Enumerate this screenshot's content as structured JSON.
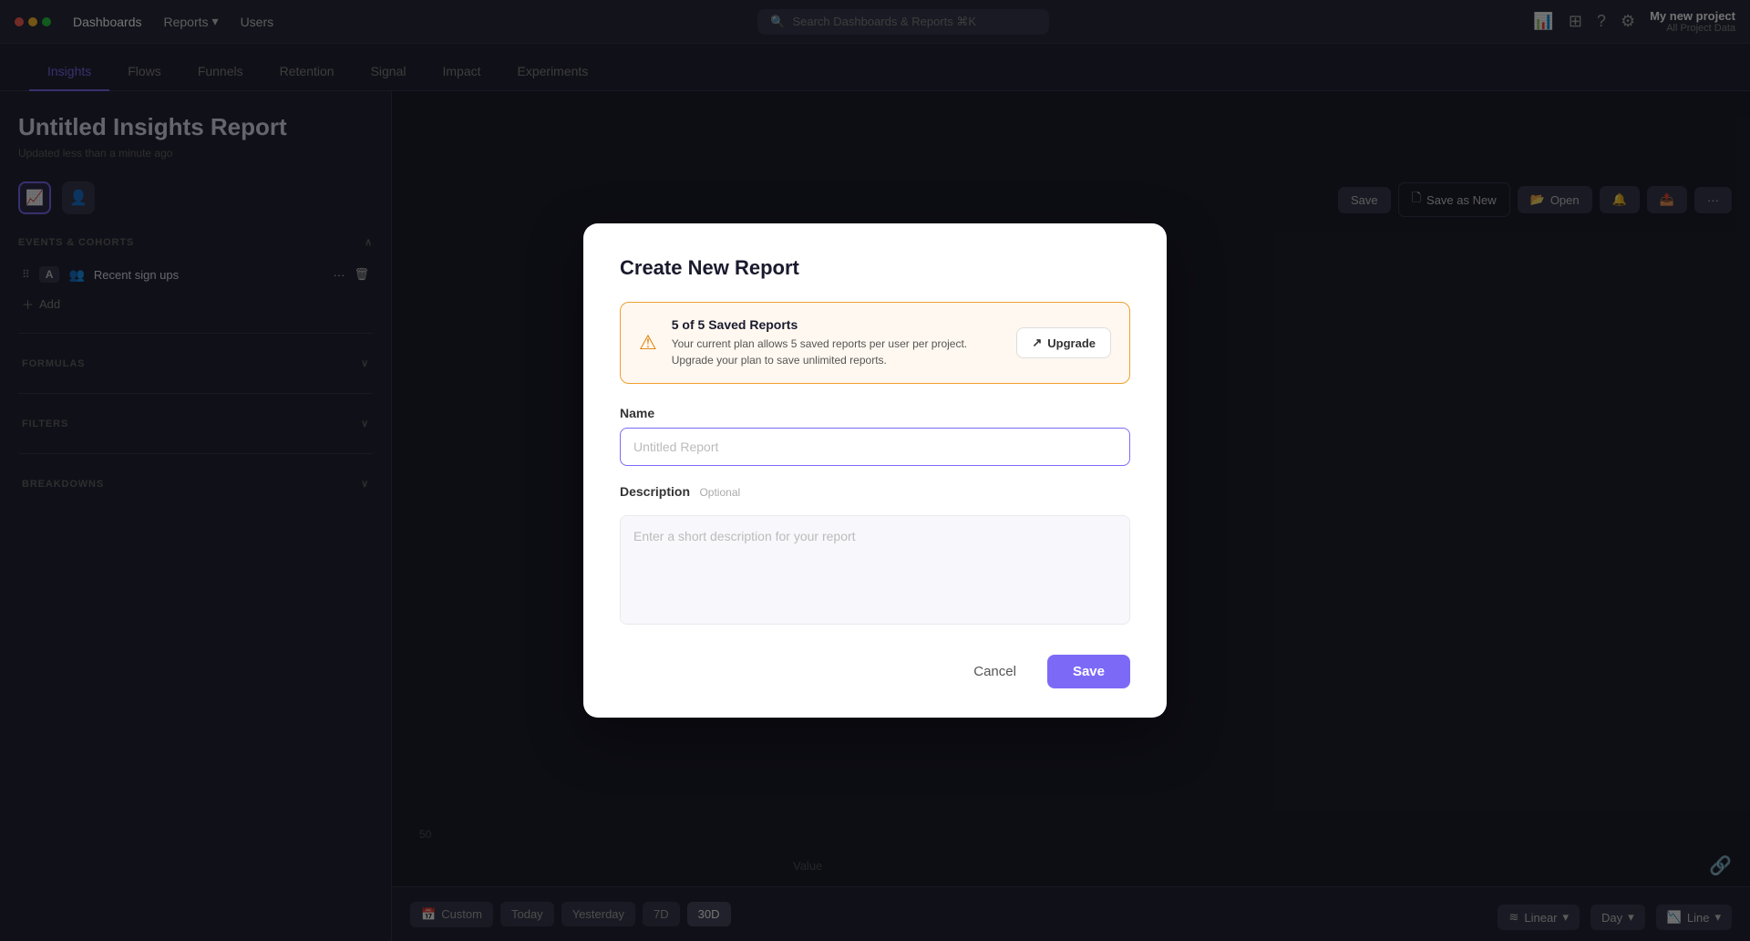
{
  "topNav": {
    "links": [
      "Dashboards",
      "Reports",
      "Users"
    ],
    "activeLink": "Reports",
    "searchPlaceholder": "Search Dashboards & Reports ⌘K",
    "project": {
      "name": "My new project",
      "sub": "All Project Data"
    }
  },
  "tabs": {
    "items": [
      "Insights",
      "Flows",
      "Funnels",
      "Retention",
      "Signal",
      "Impact",
      "Experiments"
    ],
    "active": "Insights"
  },
  "sidebar": {
    "title": "Untitled Insights Report",
    "subtitle": "Updated less than a minute ago",
    "sections": {
      "eventsAndCohorts": "EVENTS & COHORTS",
      "cohort": "Recent sign ups",
      "addLabel": "Add",
      "formulas": "FORMULAS",
      "filters": "FILTERS",
      "breakdowns": "BREAKDOWNS"
    }
  },
  "toolbar": {
    "saveLabel": "Save",
    "saveAsNewLabel": "Save as New",
    "openLabel": "Open",
    "moreLabel": "···"
  },
  "bottomBar": {
    "dateButtons": [
      "Custom",
      "Today",
      "Yesterday",
      "7D",
      "30D"
    ],
    "activeDate": "30D"
  },
  "rightControls": {
    "linear": "Linear",
    "day": "Day",
    "line": "Line"
  },
  "modal": {
    "title": "Create New Report",
    "warning": {
      "title": "5 of 5 Saved Reports",
      "description": "Your current plan allows 5 saved reports per user per project. Upgrade your plan to save unlimited reports.",
      "upgradeLabel": "Upgrade"
    },
    "nameLabel": "Name",
    "namePlaceholder": "Untitled Report",
    "descriptionLabel": "Description",
    "optionalLabel": "Optional",
    "descriptionPlaceholder": "Enter a short description for your report",
    "cancelLabel": "Cancel",
    "saveLabel": "Save"
  },
  "chart": {
    "yLabel": "Value",
    "yValue": "50"
  }
}
